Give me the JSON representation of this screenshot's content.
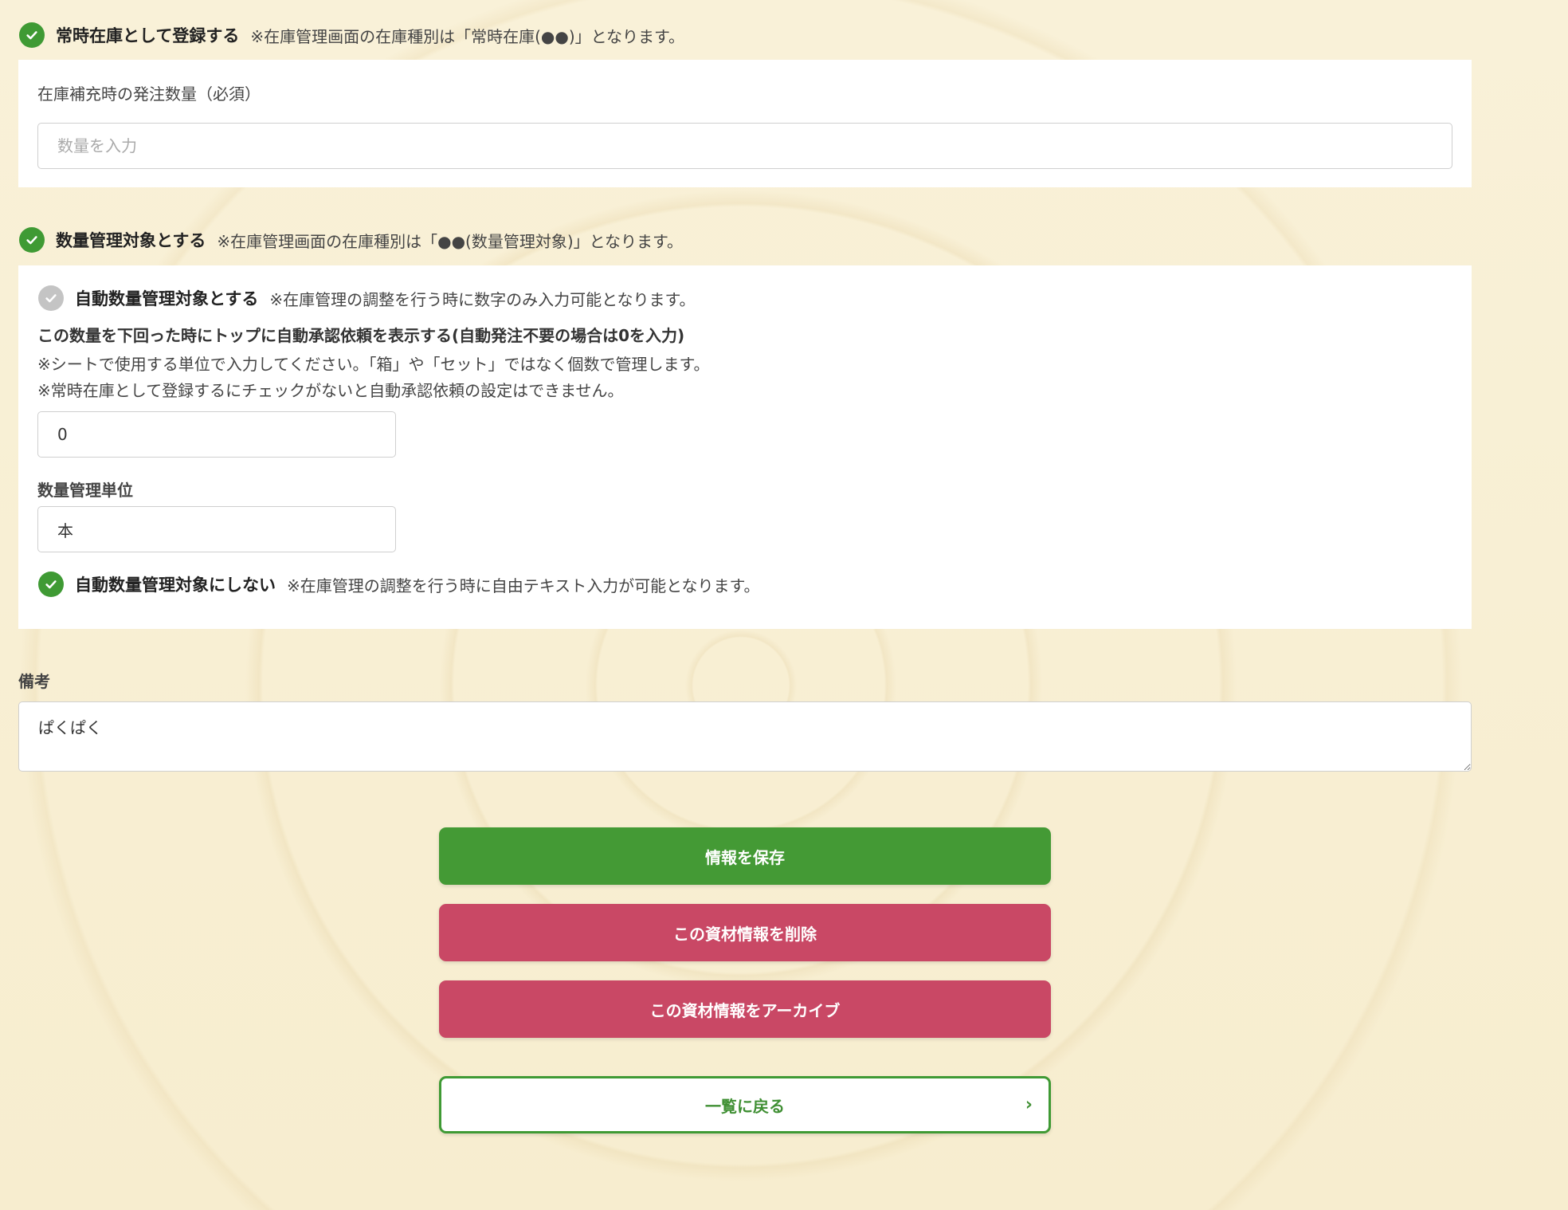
{
  "stock_option": {
    "title": "常時在庫として登録する",
    "note": "※在庫管理画面の在庫種別は「常時在庫(●●)」となります。",
    "checked": true
  },
  "reorder_field": {
    "label": "在庫補充時の発注数量（必須）",
    "placeholder": "数量を入力",
    "value": ""
  },
  "quantity_option": {
    "title": "数量管理対象とする",
    "note": "※在庫管理画面の在庫種別は「●●(数量管理対象)」となります。",
    "checked": true
  },
  "auto_quantity_option": {
    "title": "自動数量管理対象とする",
    "note": "※在庫管理の調整を行う時に数字のみ入力可能となります。",
    "checked": false
  },
  "threshold_field": {
    "label": "この数量を下回った時にトップに自動承認依頼を表示する(自動発注不要の場合は0を入力)",
    "hint1": "※シートで使用する単位で入力してください。「箱」や「セット」ではなく個数で管理します。",
    "hint2": "※常時在庫として登録するにチェックがないと自動承認依頼の設定はできません。",
    "value": "0"
  },
  "unit_field": {
    "label": "数量管理単位",
    "value": "本"
  },
  "no_auto_option": {
    "title": "自動数量管理対象にしない",
    "note": "※在庫管理の調整を行う時に自由テキスト入力が可能となります。",
    "checked": true
  },
  "remarks": {
    "label": "備考",
    "value": "ぱくぱく"
  },
  "buttons": {
    "save": "情報を保存",
    "delete": "この資材情報を削除",
    "archive": "この資材情報をアーカイブ",
    "back": "一覧に戻る"
  },
  "colors": {
    "accent_green": "#449a35",
    "danger_red": "#c94865",
    "background": "#f8efd3"
  }
}
